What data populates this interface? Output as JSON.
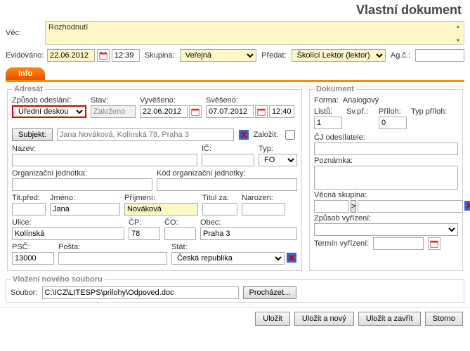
{
  "title": "Vlastní dokument",
  "header": {
    "vec_label": "Věc:",
    "vec_value": "Rozhodnutí",
    "evidovano_label": "Evidováno:",
    "evidovano_date": "22.06.2012",
    "evidovano_time": "12:39",
    "skupina_label": "Skupina:",
    "skupina_value": "Veřejná",
    "predat_label": "Předat:",
    "predat_value": "Školící Lektor (lektor)",
    "agc_label": "Ag.č.:",
    "agc_value": ""
  },
  "tab": {
    "label": "Info"
  },
  "adresat": {
    "legend": "Adresát",
    "zpusob_label": "Způsob odeslání:",
    "zpusob_value": "Úřední deskou",
    "stav_label": "Stav:",
    "stav_value": "Založeno",
    "vyveseno_label": "Vyvěšeno:",
    "vyveseno_value": "22.06.2012",
    "sveseno_label": "Svěšeno:",
    "sveseno_value": "07.07.2012",
    "sveseno_time": "12:40",
    "subjekt_btn": "Subjekt:",
    "subjekt_placeholder": "Jana Nováková, Kolínská 78, Praha 3",
    "zalozit_label": "Založit:",
    "nazev_label": "Název:",
    "ic_label": "IČ:",
    "typ_label": "Typ:",
    "typ_value": "FO",
    "org_jednotka_label": "Organizační jednotka:",
    "kod_org_label": "Kód organizační jednotky:",
    "titpred_label": "Tit.před:",
    "jmeno_label": "Jméno:",
    "jmeno_value": "Jana",
    "prijmeni_label": "Příjmení:",
    "prijmeni_value": "Nováková",
    "titza_label": "Titul za:",
    "narozen_label": "Narozen:",
    "ulice_label": "Ulice:",
    "ulice_value": "Kolínská",
    "cp_label": "ČP:",
    "cp_value": "78",
    "co_label": "ČO:",
    "obec_label": "Obec:",
    "obec_value": "Praha 3",
    "psc_label": "PSČ:",
    "psc_value": "13000",
    "posta_label": "Pošta:",
    "stat_label": "Stát:",
    "stat_value": "Česká republika"
  },
  "dokument": {
    "legend": "Dokument",
    "forma_label": "Forma:",
    "forma_value": "Analogový",
    "listu_label": "Listů:",
    "listu_value": "1",
    "svpr_label": "Sv.př.:",
    "priloh_label": "Příloh:",
    "priloh_value": "0",
    "typ_priloh_label": "Typ příloh:",
    "cj_label": "ČJ odesílatele:",
    "poznamka_label": "Poznámka:",
    "vecna_label": "Věcná skupina:",
    "vecna_btn": ">",
    "zpusob_vyrizeni_label": "Způsob vyřízení:",
    "termin_label": "Termín vyřízení:"
  },
  "upload": {
    "legend": "Vložení nového souboru",
    "soubor_label": "Soubor:",
    "soubor_value": "C:\\ICZ\\LITESPS\\prilohy\\Odpoved.doc",
    "browse": "Procházet..."
  },
  "footer": {
    "ulozit": "Uložit",
    "ulozit_novy": "Uložit a nový",
    "ulozit_zavrit": "Uložit a zavřít",
    "storno": "Storno"
  }
}
